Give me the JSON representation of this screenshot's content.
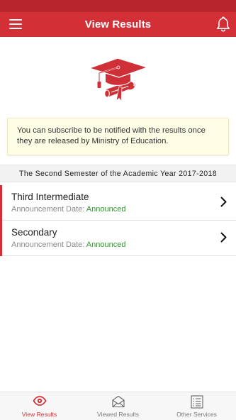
{
  "header": {
    "title": "View Results",
    "menu_icon": "hamburger-menu-icon",
    "notification_icon": "bell-icon"
  },
  "hero": {
    "icon": "graduation-cap-diploma-icon"
  },
  "notice": {
    "text": "You can subscribe to be notified with the results once they are released by Ministry of Education."
  },
  "semester": {
    "label": "The Second Semester of the Academic Year 2017-2018"
  },
  "results": [
    {
      "name": "Third Intermediate",
      "date_label": "Announcement Date: ",
      "status": "Announced"
    },
    {
      "name": "Secondary",
      "date_label": "Announcement Date: ",
      "status": "Announced"
    }
  ],
  "tabs": [
    {
      "label": "View Results",
      "icon": "eye-icon",
      "active": true
    },
    {
      "label": "Viewed Results",
      "icon": "envelope-icon",
      "active": false
    },
    {
      "label": "Other Services",
      "icon": "list-icon",
      "active": false
    }
  ],
  "colors": {
    "brand": "#d32f37",
    "status_bar": "#b8252c",
    "announced": "#3a8f3a",
    "notice_bg": "#fefde6"
  }
}
